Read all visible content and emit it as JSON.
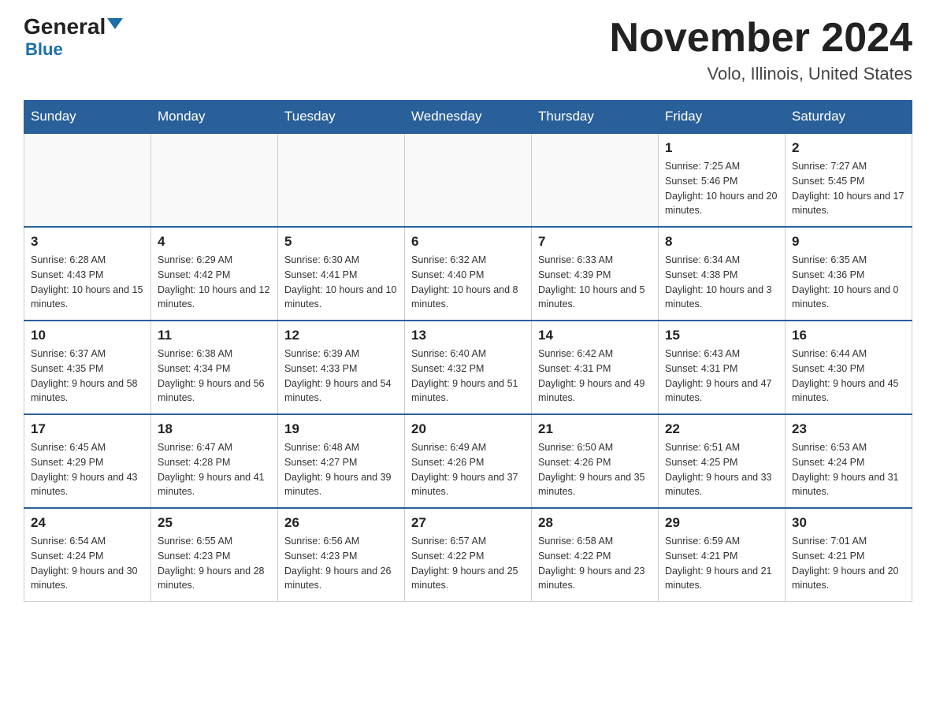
{
  "header": {
    "logo_general": "General",
    "logo_blue": "Blue",
    "month_title": "November 2024",
    "location": "Volo, Illinois, United States"
  },
  "days_of_week": [
    "Sunday",
    "Monday",
    "Tuesday",
    "Wednesday",
    "Thursday",
    "Friday",
    "Saturday"
  ],
  "weeks": [
    [
      {
        "day": "",
        "info": ""
      },
      {
        "day": "",
        "info": ""
      },
      {
        "day": "",
        "info": ""
      },
      {
        "day": "",
        "info": ""
      },
      {
        "day": "",
        "info": ""
      },
      {
        "day": "1",
        "info": "Sunrise: 7:25 AM\nSunset: 5:46 PM\nDaylight: 10 hours and 20 minutes."
      },
      {
        "day": "2",
        "info": "Sunrise: 7:27 AM\nSunset: 5:45 PM\nDaylight: 10 hours and 17 minutes."
      }
    ],
    [
      {
        "day": "3",
        "info": "Sunrise: 6:28 AM\nSunset: 4:43 PM\nDaylight: 10 hours and 15 minutes."
      },
      {
        "day": "4",
        "info": "Sunrise: 6:29 AM\nSunset: 4:42 PM\nDaylight: 10 hours and 12 minutes."
      },
      {
        "day": "5",
        "info": "Sunrise: 6:30 AM\nSunset: 4:41 PM\nDaylight: 10 hours and 10 minutes."
      },
      {
        "day": "6",
        "info": "Sunrise: 6:32 AM\nSunset: 4:40 PM\nDaylight: 10 hours and 8 minutes."
      },
      {
        "day": "7",
        "info": "Sunrise: 6:33 AM\nSunset: 4:39 PM\nDaylight: 10 hours and 5 minutes."
      },
      {
        "day": "8",
        "info": "Sunrise: 6:34 AM\nSunset: 4:38 PM\nDaylight: 10 hours and 3 minutes."
      },
      {
        "day": "9",
        "info": "Sunrise: 6:35 AM\nSunset: 4:36 PM\nDaylight: 10 hours and 0 minutes."
      }
    ],
    [
      {
        "day": "10",
        "info": "Sunrise: 6:37 AM\nSunset: 4:35 PM\nDaylight: 9 hours and 58 minutes."
      },
      {
        "day": "11",
        "info": "Sunrise: 6:38 AM\nSunset: 4:34 PM\nDaylight: 9 hours and 56 minutes."
      },
      {
        "day": "12",
        "info": "Sunrise: 6:39 AM\nSunset: 4:33 PM\nDaylight: 9 hours and 54 minutes."
      },
      {
        "day": "13",
        "info": "Sunrise: 6:40 AM\nSunset: 4:32 PM\nDaylight: 9 hours and 51 minutes."
      },
      {
        "day": "14",
        "info": "Sunrise: 6:42 AM\nSunset: 4:31 PM\nDaylight: 9 hours and 49 minutes."
      },
      {
        "day": "15",
        "info": "Sunrise: 6:43 AM\nSunset: 4:31 PM\nDaylight: 9 hours and 47 minutes."
      },
      {
        "day": "16",
        "info": "Sunrise: 6:44 AM\nSunset: 4:30 PM\nDaylight: 9 hours and 45 minutes."
      }
    ],
    [
      {
        "day": "17",
        "info": "Sunrise: 6:45 AM\nSunset: 4:29 PM\nDaylight: 9 hours and 43 minutes."
      },
      {
        "day": "18",
        "info": "Sunrise: 6:47 AM\nSunset: 4:28 PM\nDaylight: 9 hours and 41 minutes."
      },
      {
        "day": "19",
        "info": "Sunrise: 6:48 AM\nSunset: 4:27 PM\nDaylight: 9 hours and 39 minutes."
      },
      {
        "day": "20",
        "info": "Sunrise: 6:49 AM\nSunset: 4:26 PM\nDaylight: 9 hours and 37 minutes."
      },
      {
        "day": "21",
        "info": "Sunrise: 6:50 AM\nSunset: 4:26 PM\nDaylight: 9 hours and 35 minutes."
      },
      {
        "day": "22",
        "info": "Sunrise: 6:51 AM\nSunset: 4:25 PM\nDaylight: 9 hours and 33 minutes."
      },
      {
        "day": "23",
        "info": "Sunrise: 6:53 AM\nSunset: 4:24 PM\nDaylight: 9 hours and 31 minutes."
      }
    ],
    [
      {
        "day": "24",
        "info": "Sunrise: 6:54 AM\nSunset: 4:24 PM\nDaylight: 9 hours and 30 minutes."
      },
      {
        "day": "25",
        "info": "Sunrise: 6:55 AM\nSunset: 4:23 PM\nDaylight: 9 hours and 28 minutes."
      },
      {
        "day": "26",
        "info": "Sunrise: 6:56 AM\nSunset: 4:23 PM\nDaylight: 9 hours and 26 minutes."
      },
      {
        "day": "27",
        "info": "Sunrise: 6:57 AM\nSunset: 4:22 PM\nDaylight: 9 hours and 25 minutes."
      },
      {
        "day": "28",
        "info": "Sunrise: 6:58 AM\nSunset: 4:22 PM\nDaylight: 9 hours and 23 minutes."
      },
      {
        "day": "29",
        "info": "Sunrise: 6:59 AM\nSunset: 4:21 PM\nDaylight: 9 hours and 21 minutes."
      },
      {
        "day": "30",
        "info": "Sunrise: 7:01 AM\nSunset: 4:21 PM\nDaylight: 9 hours and 20 minutes."
      }
    ]
  ]
}
